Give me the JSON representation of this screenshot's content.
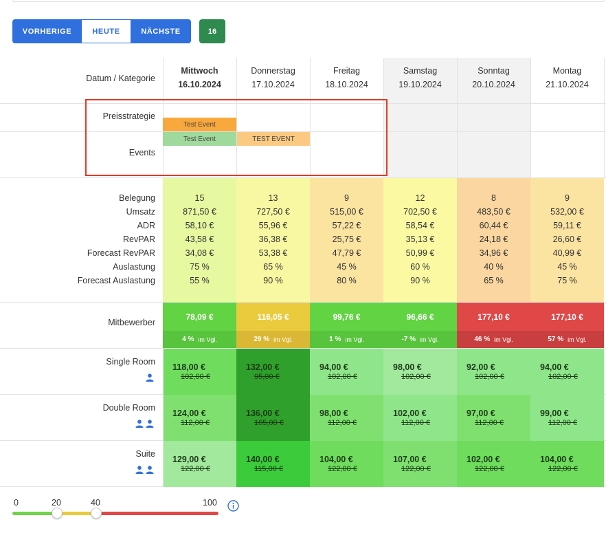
{
  "nav": {
    "prev_label": "VORHERIGE",
    "today_label": "HEUTE",
    "next_label": "NÄCHSTE",
    "count_badge": "16"
  },
  "colors": {
    "primary": "#2f6fde",
    "badge": "#2e8a4e",
    "weekend_bg": "#f2f2f2"
  },
  "header": {
    "row_label": "Datum / Kategorie",
    "days": [
      {
        "name": "Mittwoch",
        "date": "16.10.2024",
        "today": true
      },
      {
        "name": "Donnerstag",
        "date": "17.10.2024"
      },
      {
        "name": "Freitag",
        "date": "18.10.2024"
      },
      {
        "name": "Samstag",
        "date": "19.10.2024"
      },
      {
        "name": "Sonntag",
        "date": "20.10.2024"
      },
      {
        "name": "Montag",
        "date": "21.10.2024"
      }
    ]
  },
  "events_section": {
    "strategy_label": "Preisstrategie",
    "events_label": "Events",
    "strategy_tag": "Test Event",
    "event_tags": [
      "Test Event",
      "TEST EVENT"
    ]
  },
  "metrics": {
    "labels": [
      "Belegung",
      "Umsatz",
      "ADR",
      "RevPAR",
      "Forecast RevPAR",
      "Auslastung",
      "Forecast Auslastung"
    ],
    "columns": [
      [
        "15",
        "871,50 €",
        "58,10 €",
        "43,58 €",
        "34,08 €",
        "75 %",
        "55 %"
      ],
      [
        "13",
        "727,50 €",
        "55,96 €",
        "36,38 €",
        "53,38 €",
        "65 %",
        "90 %"
      ],
      [
        "9",
        "515,00 €",
        "57,22 €",
        "25,75 €",
        "47,79 €",
        "45 %",
        "80 %"
      ],
      [
        "12",
        "702,50 €",
        "58,54 €",
        "35,13 €",
        "50,99 €",
        "60 %",
        "90 %"
      ],
      [
        "8",
        "483,50 €",
        "60,44 €",
        "24,18 €",
        "34,96 €",
        "40 %",
        "65 %"
      ],
      [
        "9",
        "532,00 €",
        "59,11 €",
        "26,60 €",
        "40,99 €",
        "45 %",
        "75 %"
      ]
    ],
    "bg_colors": [
      "#e6f8a0",
      "#f8f8a2",
      "#fbe3a0",
      "#fbfaa3",
      "#fbd6a0",
      "#fbe3a2"
    ]
  },
  "competitors": {
    "label": "Mitbewerber",
    "vgl_label": "im Vgl.",
    "items": [
      {
        "price": "78,09 €",
        "pct": "4 %",
        "top": "#62d343",
        "bottom": "#58c43d"
      },
      {
        "price": "116,05 €",
        "pct": "29 %",
        "top": "#eacb3e",
        "bottom": "#dab835"
      },
      {
        "price": "99,76 €",
        "pct": "1 %",
        "top": "#62d343",
        "bottom": "#58c43d"
      },
      {
        "price": "96,66 €",
        "pct": "-7 %",
        "top": "#62d343",
        "bottom": "#58c43d"
      },
      {
        "price": "177,10 €",
        "pct": "46 %",
        "top": "#e04848",
        "bottom": "#c93f3f"
      },
      {
        "price": "177,10 €",
        "pct": "57 %",
        "top": "#e04848",
        "bottom": "#c93f3f"
      }
    ]
  },
  "rooms": [
    {
      "name": "Single Room",
      "persons": 1,
      "cells": [
        {
          "price": "118,00 €",
          "old": "102,00 €",
          "bg": "#6fdc5d"
        },
        {
          "price": "132,00 €",
          "old": "95,00 €",
          "bg": "#2fa02b"
        },
        {
          "price": "94,00 €",
          "old": "102,00 €",
          "bg": "#8fe58a"
        },
        {
          "price": "98,00 €",
          "old": "102,00 €",
          "bg": "#a2e89d"
        },
        {
          "price": "92,00 €",
          "old": "102,00 €",
          "bg": "#8fe58a"
        },
        {
          "price": "94,00 €",
          "old": "102,00 €",
          "bg": "#8fe58a"
        }
      ]
    },
    {
      "name": "Double Room",
      "persons": 2,
      "cells": [
        {
          "price": "124,00 €",
          "old": "112,00 €",
          "bg": "#7fe070"
        },
        {
          "price": "136,00 €",
          "old": "105,00 €",
          "bg": "#2fa02b"
        },
        {
          "price": "98,00 €",
          "old": "112,00 €",
          "bg": "#7fe070"
        },
        {
          "price": "102,00 €",
          "old": "112,00 €",
          "bg": "#8fe58a"
        },
        {
          "price": "97,00 €",
          "old": "112,00 €",
          "bg": "#7fe070"
        },
        {
          "price": "99,00 €",
          "old": "112,00 €",
          "bg": "#8fe58a"
        }
      ]
    },
    {
      "name": "Suite",
      "persons": 2,
      "cells": [
        {
          "price": "129,00 €",
          "old": "122,00 €",
          "bg": "#a2e89d"
        },
        {
          "price": "140,00 €",
          "old": "115,00 €",
          "bg": "#3bcb3b"
        },
        {
          "price": "104,00 €",
          "old": "122,00 €",
          "bg": "#6fdc5d"
        },
        {
          "price": "107,00 €",
          "old": "122,00 €",
          "bg": "#7fe070"
        },
        {
          "price": "102,00 €",
          "old": "122,00 €",
          "bg": "#6fdc5d"
        },
        {
          "price": "104,00 €",
          "old": "122,00 €",
          "bg": "#6fdc5d"
        }
      ]
    }
  ],
  "scale": {
    "min": "0",
    "t1": "20",
    "t2": "40",
    "max": "100",
    "low_color": "#6fd34a",
    "mid_color": "#eacb3e",
    "high_color": "#e04848",
    "info_icon": "info-circle-icon"
  }
}
